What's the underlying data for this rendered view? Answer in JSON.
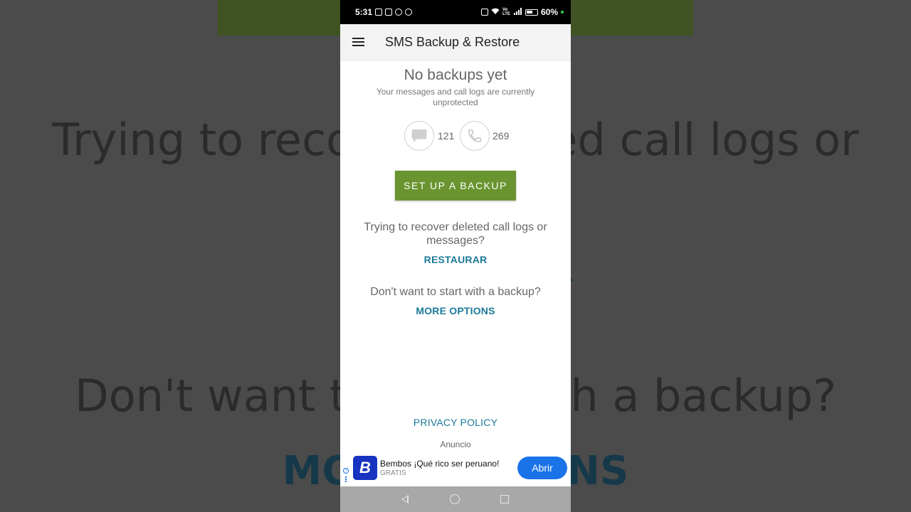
{
  "background": {
    "line1": "Trying to recover deleted call logs or",
    "line2": "RESTAURAR",
    "line3": "Don't want to start with a backup?",
    "line4": "MORE OPTIONS"
  },
  "status_bar": {
    "time": "5:31",
    "battery_percent": "60%",
    "battery_level": 0.6,
    "network_label": "Vo LTE"
  },
  "app_bar": {
    "title": "SMS Backup & Restore",
    "menu_icon": "hamburger-menu-icon"
  },
  "main": {
    "heading": "No backups yet",
    "subtext": "Your messages and call logs are currently unprotected",
    "message_count": "121",
    "call_count": "269",
    "message_icon": "message-bubble-icon",
    "call_icon": "phone-icon",
    "setup_button": "SET UP A BACKUP",
    "recover_question": "Trying to recover deleted call logs or messages?",
    "restore_link": "RESTAURAR",
    "options_question": "Don't want to start with a backup?",
    "more_options_link": "MORE OPTIONS",
    "privacy_link": "PRIVACY POLICY"
  },
  "ad": {
    "label": "Anuncio",
    "logo_letter": "B",
    "name": "Bembos ¡Qué rico ser peruano!",
    "price": "GRATIS",
    "button": "Abrir"
  },
  "colors": {
    "accent_green": "#6a9430",
    "link_blue": "#1b7a99",
    "ad_blue": "#1a73e8"
  }
}
